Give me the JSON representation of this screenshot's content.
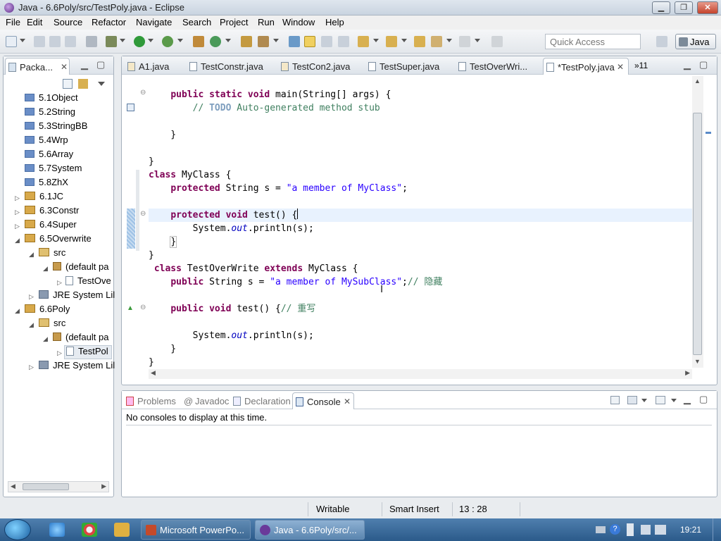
{
  "window": {
    "title": "Java - 6.6Poly/src/TestPoly.java - Eclipse",
    "min": "▁",
    "max": "❐",
    "close": "✕"
  },
  "menu": [
    "File",
    "Edit",
    "Source",
    "Refactor",
    "Navigate",
    "Search",
    "Project",
    "Run",
    "Window",
    "Help"
  ],
  "toolbar": {
    "quick_access_placeholder": "Quick Access",
    "perspective": "Java"
  },
  "package_explorer": {
    "tab_label": "Packa...",
    "items": [
      {
        "label": "5.1Object",
        "kind": "folder"
      },
      {
        "label": "5.2String",
        "kind": "folder"
      },
      {
        "label": "5.3StringBB",
        "kind": "folder"
      },
      {
        "label": "5.4Wrp",
        "kind": "folder"
      },
      {
        "label": "5.6Array",
        "kind": "folder"
      },
      {
        "label": "5.7System",
        "kind": "folder"
      },
      {
        "label": "5.8ZhX",
        "kind": "folder"
      },
      {
        "label": "6.1JC",
        "kind": "project"
      },
      {
        "label": "6.3Constr",
        "kind": "project"
      },
      {
        "label": "6.4Super",
        "kind": "project"
      },
      {
        "label": "6.5Overwrite",
        "kind": "project"
      },
      {
        "label": "src",
        "kind": "src"
      },
      {
        "label": "(default pa",
        "kind": "package"
      },
      {
        "label": "TestOve",
        "kind": "file"
      },
      {
        "label": "JRE System Lil",
        "kind": "library"
      },
      {
        "label": "6.6Poly",
        "kind": "project"
      },
      {
        "label": "src",
        "kind": "src"
      },
      {
        "label": "(default pa",
        "kind": "package"
      },
      {
        "label": "TestPol",
        "kind": "file"
      },
      {
        "label": "JRE System Lil",
        "kind": "library"
      }
    ]
  },
  "editor": {
    "tabs": [
      "A1.java",
      "TestConstr.java",
      "TestCon2.java",
      "TestSuper.java",
      "TestOverWri...",
      "*TestPoly.java"
    ],
    "overflow": "»11",
    "active_tab": "*TestPoly.java",
    "lines": [
      "    public static void main(String[] args) {",
      "        // TODO Auto-generated method stub",
      "",
      "    }",
      "",
      "}",
      "class MyClass {",
      "    protected String s = \"a member of MyClass\";",
      "",
      "    protected void test() {",
      "        System.out.println(s);",
      "    }",
      "}",
      " class TestOverWrite extends MyClass {",
      "    public String s = \"a member of MySubClass\";// 隐藏",
      "",
      "    public void test() {// 重写",
      "",
      "        System.out.println(s);",
      "    }",
      "}"
    ]
  },
  "bottom_panel": {
    "tabs": [
      "Problems",
      "Javadoc",
      "Declaration",
      "Console"
    ],
    "active_tab": "Console",
    "message": "No consoles to display at this time."
  },
  "status": {
    "writable": "Writable",
    "insert_mode": "Smart Insert",
    "position": "13 : 28"
  },
  "taskbar": {
    "tasks": [
      "Microsoft PowerPo...",
      "Java - 6.6Poly/src/..."
    ],
    "time": "19:21"
  }
}
